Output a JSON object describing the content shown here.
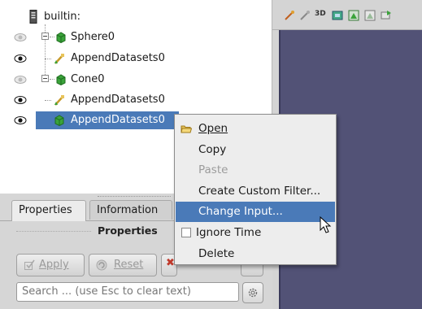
{
  "pipeline": {
    "root_label": "builtin:",
    "items": [
      {
        "label": "Sphere0",
        "icon": "cube-green-icon",
        "visible": "dim"
      },
      {
        "label": "AppendDatasets0",
        "icon": "filter-icon",
        "visible": "on"
      },
      {
        "label": "Cone0",
        "icon": "cube-green-icon",
        "visible": "dim"
      },
      {
        "label": "AppendDatasets0",
        "icon": "filter-icon",
        "visible": "on"
      },
      {
        "label": "AppendDatasets0",
        "icon": "cube-green-icon",
        "visible": "on",
        "selected": true
      }
    ]
  },
  "tabs": [
    {
      "label": "Properties",
      "active": true
    },
    {
      "label": "Information",
      "active": false
    }
  ],
  "properties": {
    "section_title": "Properties",
    "apply_label": "Apply",
    "reset_label": "Reset",
    "search_placeholder": "Search ... (use Esc to clear text)"
  },
  "toolbar": {
    "label_3d": "3D"
  },
  "context_menu": {
    "items": [
      {
        "label": "Open",
        "icon": "folder-open-icon",
        "state": "normal"
      },
      {
        "label": "Copy",
        "state": "normal"
      },
      {
        "label": "Paste",
        "state": "disabled"
      },
      {
        "label": "Create Custom Filter...",
        "state": "normal"
      },
      {
        "label": "Change Input...",
        "state": "highlighted"
      },
      {
        "label": "Ignore Time",
        "state": "checkbox"
      },
      {
        "label": "Delete",
        "state": "normal"
      }
    ]
  },
  "colors": {
    "selection": "#4a7ab8",
    "render_background": "#525276",
    "cube_green": "#3aa33a"
  }
}
